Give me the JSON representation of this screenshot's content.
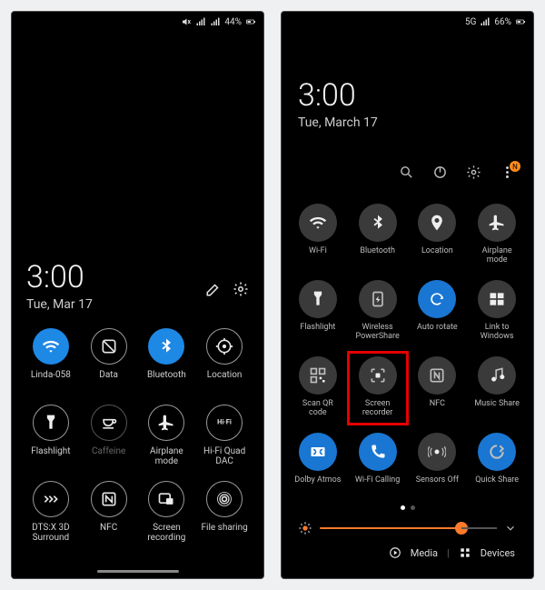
{
  "left": {
    "status": {
      "batteryText": "44%"
    },
    "clock": {
      "time": "3:00",
      "date": "Tue, Mar 17"
    },
    "tiles": [
      {
        "name": "wifi",
        "label": "Linda-058",
        "state": "on",
        "icon": "wifi"
      },
      {
        "name": "data",
        "label": "Data",
        "state": "off",
        "icon": "data"
      },
      {
        "name": "bluetooth",
        "label": "Bluetooth",
        "state": "on",
        "icon": "bluetooth"
      },
      {
        "name": "location",
        "label": "Location",
        "state": "off",
        "icon": "location"
      },
      {
        "name": "flashlight",
        "label": "Flashlight",
        "state": "off",
        "icon": "flashlight"
      },
      {
        "name": "caffeine",
        "label": "Caffeine",
        "state": "dim",
        "icon": "coffee"
      },
      {
        "name": "airplane",
        "label": "Airplane mode",
        "state": "off",
        "icon": "airplane"
      },
      {
        "name": "hifi",
        "label": "Hi-Fi Quad DAC",
        "state": "off",
        "icon": "hifi"
      },
      {
        "name": "dtsx",
        "label": "DTS:X 3D Surround",
        "state": "off",
        "icon": "dtsx"
      },
      {
        "name": "nfc",
        "label": "NFC",
        "state": "off",
        "icon": "nfc"
      },
      {
        "name": "screenrec",
        "label": "Screen recording",
        "state": "off",
        "icon": "screenrec-l"
      },
      {
        "name": "fileshare",
        "label": "File sharing",
        "state": "off",
        "icon": "fileshare"
      }
    ]
  },
  "right": {
    "status": {
      "network": "5G",
      "batteryText": "66%"
    },
    "clock": {
      "time": "3:00",
      "date": "Tue, March 17"
    },
    "badge": "N",
    "tiles": [
      {
        "name": "wifi",
        "label": "Wi-Fi",
        "state": "off",
        "icon": "wifi"
      },
      {
        "name": "bluetooth",
        "label": "Bluetooth",
        "state": "off",
        "icon": "bluetooth"
      },
      {
        "name": "location",
        "label": "Location",
        "state": "off",
        "icon": "location-pin"
      },
      {
        "name": "airplane",
        "label": "Airplane mode",
        "state": "off",
        "icon": "airplane"
      },
      {
        "name": "flashlight",
        "label": "Flashlight",
        "state": "off",
        "icon": "flashlight"
      },
      {
        "name": "powershare",
        "label": "Wireless PowerShare",
        "state": "off",
        "icon": "powershare"
      },
      {
        "name": "autorotate",
        "label": "Auto rotate",
        "state": "on",
        "icon": "rotate"
      },
      {
        "name": "linkwindows",
        "label": "Link to Windows",
        "state": "off",
        "icon": "windows"
      },
      {
        "name": "qr",
        "label": "Scan QR code",
        "state": "off",
        "icon": "qr"
      },
      {
        "name": "screenrec",
        "label": "Screen recorder",
        "state": "off",
        "icon": "screenrec",
        "highlight": true
      },
      {
        "name": "nfc",
        "label": "NFC",
        "state": "off",
        "icon": "nfc-sq"
      },
      {
        "name": "musicshare",
        "label": "Music Share",
        "state": "off",
        "icon": "music"
      },
      {
        "name": "dolby",
        "label": "Dolby Atmos",
        "state": "on",
        "icon": "dolby"
      },
      {
        "name": "wificall",
        "label": "Wi-Fi Calling",
        "state": "on",
        "icon": "wificall"
      },
      {
        "name": "sensors",
        "label": "Sensors Off",
        "state": "off",
        "icon": "sensors"
      },
      {
        "name": "quickshare",
        "label": "Quick Share",
        "state": "on",
        "icon": "quickshare"
      }
    ],
    "bottom": {
      "media": "Media",
      "devices": "Devices"
    },
    "brightness": 80
  }
}
